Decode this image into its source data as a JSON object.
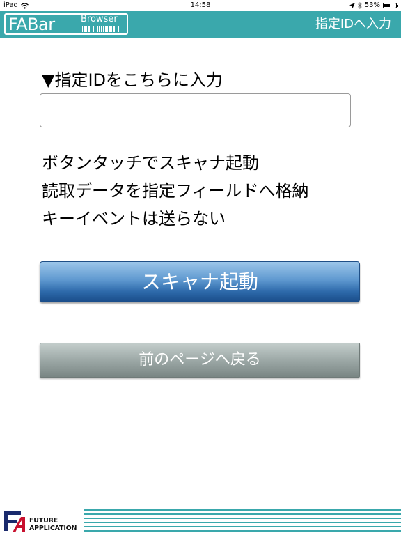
{
  "status_bar": {
    "device": "iPad",
    "time": "14:58",
    "battery_percent": "53%",
    "battery_level": 0.53
  },
  "header": {
    "logo_main": "FABar",
    "logo_sub": "Browser",
    "title": "指定IDへ入力"
  },
  "main": {
    "input_label": "▼指定IDをこちらに入力",
    "id_field": {
      "value": "",
      "placeholder": ""
    },
    "description": [
      "ボタンタッチでスキャナ起動",
      "読取データを指定フィールドへ格納",
      "キーイベントは送らない"
    ],
    "scan_button_label": "スキャナ起動",
    "back_button_label": "前のページへ戻る"
  },
  "footer": {
    "company_line1": "FUTURE",
    "company_line2": "APPLICATION"
  },
  "colors": {
    "accent": "#3aa8ac",
    "primary_button": "#2d69aa",
    "secondary_button": "#99a5a3"
  },
  "icons": {
    "wifi": "wifi-icon",
    "location": "location-arrow-icon",
    "bluetooth": "bluetooth-icon",
    "battery": "battery-icon"
  }
}
